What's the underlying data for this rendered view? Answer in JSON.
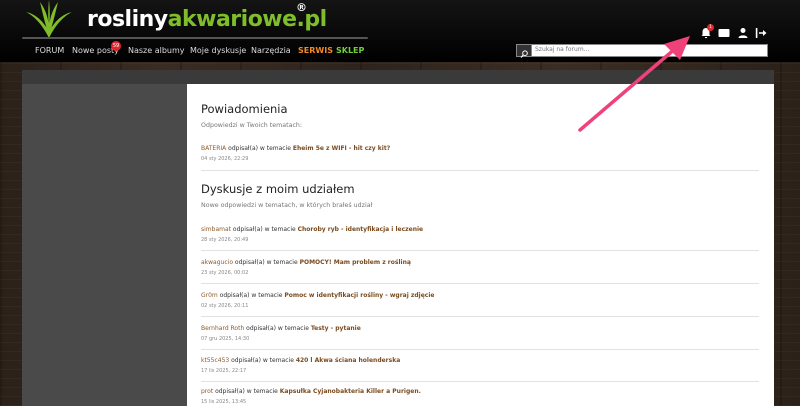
{
  "logo": {
    "part1": "rosliny",
    "part2": "akwariowe.pl",
    "reg": "®"
  },
  "nav": {
    "items": [
      {
        "label": "FORUM"
      },
      {
        "label": "Nowe posty",
        "badge": "59"
      },
      {
        "label": "Nasze albumy"
      },
      {
        "label": "Moje dyskusje"
      },
      {
        "label": "Narzędzia"
      },
      {
        "label": "SERWIS"
      },
      {
        "label": "SKLEP"
      }
    ]
  },
  "header_icons": {
    "bell_badge": "1"
  },
  "search": {
    "placeholder": "Szukaj na forum..."
  },
  "notifications": {
    "title": "Powiadomienia",
    "subtitle": "Odpowiedzi w Twoich tematach:",
    "items": [
      {
        "user": "BATERIA",
        "action": " odpisał(a) w temacie ",
        "topic": "Eheim 5e z WIFI - hit czy kit?",
        "date": "04 sty 2026, 22:29"
      }
    ]
  },
  "discussions": {
    "title": "Dyskusje z moim udziałem",
    "subtitle": "Nowe odpowiedzi w tematach, w których brałeś udział",
    "items": [
      {
        "user": "simbamat",
        "action": " odpisał(a) w temacie ",
        "topic": "Choroby ryb - identyfikacja i leczenie",
        "date": "28 sty 2026, 20:49"
      },
      {
        "user": "akwagucio",
        "action": " odpisał(a) w temacie ",
        "topic": "POMOCY! Mam problem z rośliną",
        "date": "23 sty 2026, 00:02"
      },
      {
        "user": "Gr0m",
        "action": " odpisał(a) w temacie ",
        "topic": "Pomoc w identyfikacji rośliny - wgraj zdjęcie",
        "date": "02 sty 2026, 20:11"
      },
      {
        "user": "Bernhard Roth",
        "action": " odpisał(a) w temacie ",
        "topic": "Testy - pytanie",
        "date": "07 gru 2025, 14:30"
      },
      {
        "user": "kt55c453",
        "action": " odpisał(a) w temacie ",
        "topic": "420 l Akwa ściana holenderska",
        "date": "17 lis 2025, 22:17"
      },
      {
        "user": "prot",
        "action": " odpisał(a) w temacie ",
        "topic": "Kapsułka Cyjanobakteria Killer a Purigen.",
        "date": "15 lis 2025, 13:45"
      }
    ]
  },
  "colors": {
    "accent_green": "#7fbd2a",
    "serwis": "#f08a24",
    "sklep": "#6fcf3a",
    "badge": "#e3262e",
    "arrow": "#f0427a"
  }
}
